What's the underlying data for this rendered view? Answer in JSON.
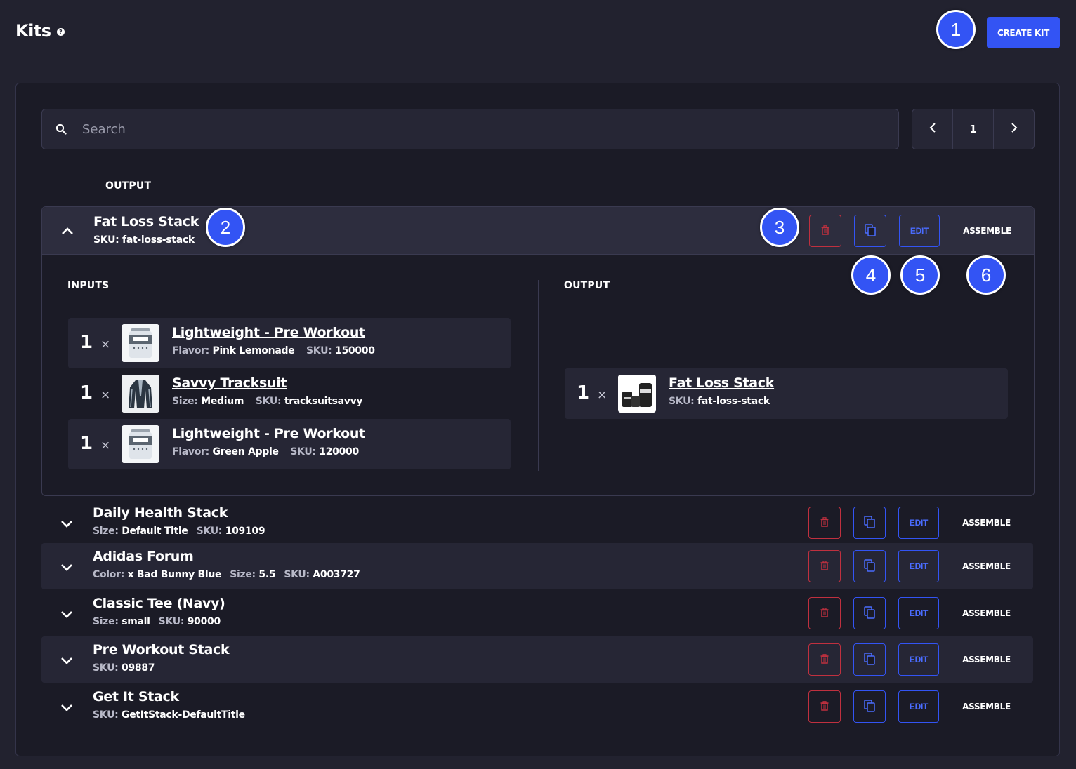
{
  "header": {
    "title": "Kits",
    "help_icon": "?",
    "create_button": "CREATE KIT"
  },
  "markers": [
    "1",
    "2",
    "3",
    "4",
    "5",
    "6"
  ],
  "search": {
    "placeholder": "Search"
  },
  "pagination": {
    "page": "1"
  },
  "columns": {
    "output": "OUTPUT"
  },
  "actions": {
    "edit": "EDIT",
    "assemble": "ASSEMBLE"
  },
  "expanded_kit": {
    "name": "Fat Loss Stack",
    "sku_label": "SKU:",
    "sku": "fat-loss-stack",
    "inputs_label": "INPUTS",
    "output_label": "OUTPUT",
    "inputs": [
      {
        "qty": "1",
        "times": "×",
        "name": "Lightweight - Pre Workout",
        "attr_label": "Flavor:",
        "attr_value": "Pink Lemonade",
        "sku_label": "SKU:",
        "sku": "150000",
        "thumb": "bulk-tub-image"
      },
      {
        "qty": "1",
        "times": "×",
        "name": "Savvy Tracksuit",
        "attr_label": "Size:",
        "attr_value": "Medium",
        "sku_label": "SKU:",
        "sku": "tracksuitsavvy",
        "thumb": "tracksuit-image"
      },
      {
        "qty": "1",
        "times": "×",
        "name": "Lightweight - Pre Workout",
        "attr_label": "Flavor:",
        "attr_value": "Green Apple",
        "sku_label": "SKU:",
        "sku": "120000",
        "thumb": "bulk-tub-image"
      }
    ],
    "output": {
      "qty": "1",
      "times": "×",
      "name": "Fat Loss Stack",
      "sku_label": "SKU:",
      "sku": "fat-loss-stack",
      "thumb": "supplement-stack-image"
    }
  },
  "kits": [
    {
      "name": "Daily Health Stack",
      "meta": [
        {
          "label": "Size:",
          "value": "Default Title"
        },
        {
          "label": "SKU:",
          "value": "109109"
        }
      ]
    },
    {
      "name": "Adidas Forum",
      "meta": [
        {
          "label": "Color:",
          "value": "x Bad Bunny Blue"
        },
        {
          "label": "Size:",
          "value": "5.5"
        },
        {
          "label": "SKU:",
          "value": "A003727"
        }
      ]
    },
    {
      "name": "Classic Tee (Navy)",
      "meta": [
        {
          "label": "Size:",
          "value": "small"
        },
        {
          "label": "SKU:",
          "value": "90000"
        }
      ]
    },
    {
      "name": "Pre Workout Stack",
      "meta": [
        {
          "label": "SKU:",
          "value": "09887"
        }
      ]
    },
    {
      "name": "Get It Stack",
      "meta": [
        {
          "label": "SKU:",
          "value": "GetItStack-DefaultTitle"
        }
      ]
    }
  ],
  "icons": {
    "search": "search-icon",
    "prev": "chevron-left-icon",
    "next": "chevron-right-icon",
    "collapse": "chevron-up-icon",
    "expand": "chevron-down-icon",
    "delete": "trash-icon",
    "copy": "copy-icon"
  },
  "colors": {
    "background": "#22222f",
    "card": "#1b1b26",
    "accent": "#3354f4",
    "danger": "#c0303f"
  }
}
